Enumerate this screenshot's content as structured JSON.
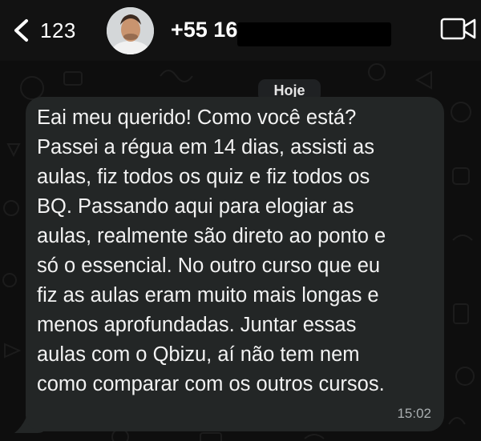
{
  "header": {
    "back_icon": "chevron-left-icon",
    "back_count": "123",
    "contact_name": "+55 16",
    "video_icon": "video-camera-icon"
  },
  "chat": {
    "date_label": "Hoje",
    "message": {
      "text": "Eai meu querido! Como você está?\nPassei a régua em 14 dias, assisti as\naulas, fiz todos os quiz e fiz todos os\nBQ. Passando aqui para elogiar as\naulas, realmente são direto ao ponto e\nsó o essencial. No outro curso que eu\nfiz as aulas eram muito mais longas e\nmenos aprofundadas. Juntar essas\naulas com o Qbizu, aí não tem nem\ncomo comparar com os outros cursos.",
      "time": "15:02"
    }
  },
  "colors": {
    "background": "#0b0b0b",
    "header": "#121212",
    "bubble": "#232626",
    "date_chip": "#1f2123",
    "timestamp": "#a9aeb0"
  }
}
